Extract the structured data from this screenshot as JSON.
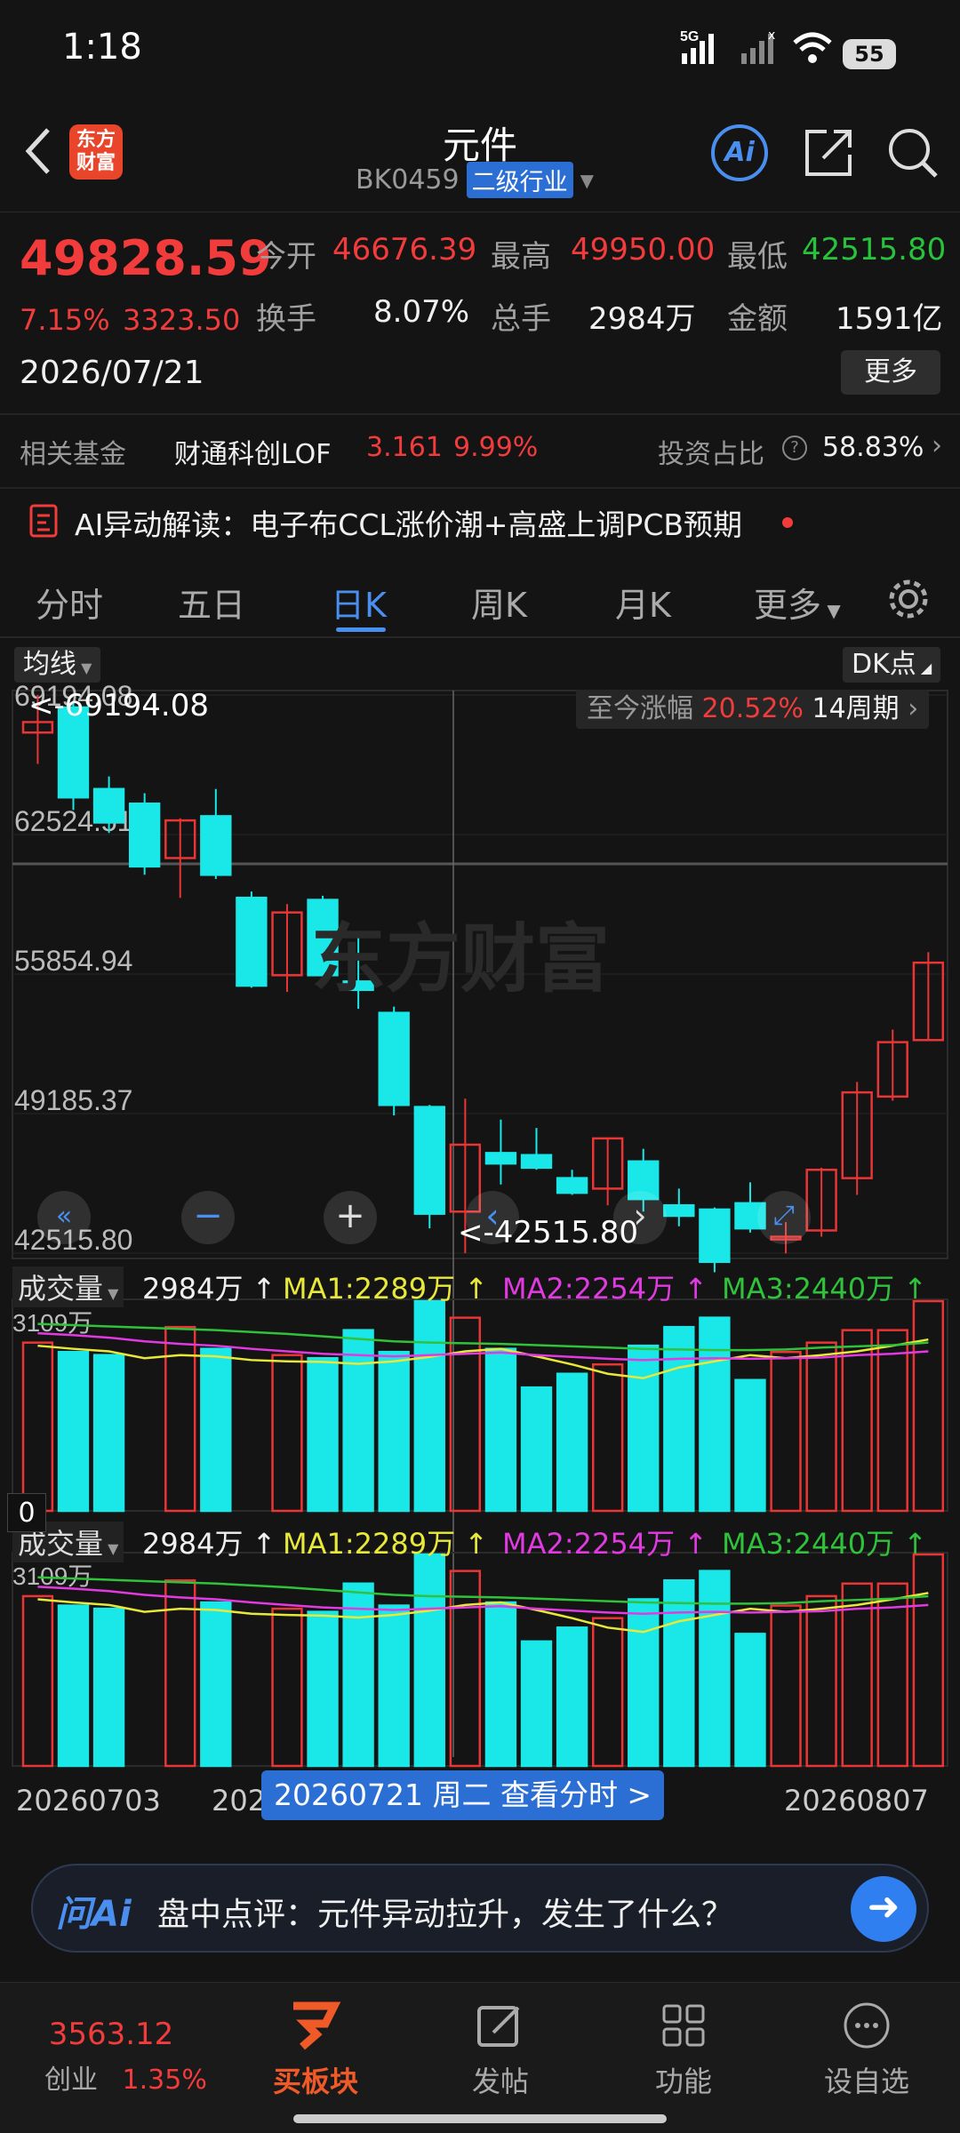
{
  "status": {
    "time": "1:18",
    "battery": "55",
    "network": "5G"
  },
  "header": {
    "title": "元件",
    "code": "BK0459",
    "category": "二级行业",
    "logo_text_line1": "东方",
    "logo_text_line2": "财富",
    "ai_label": "Ai"
  },
  "quote": {
    "price": "49828.59",
    "pct": "7.15%",
    "change": "3323.50",
    "date": "2026/07/21",
    "open_label": "今开",
    "open": "46676.39",
    "high_label": "最高",
    "high": "49950.00",
    "low_label": "最低",
    "low": "42515.80",
    "turnover_label": "换手",
    "turnover": "8.07%",
    "volume_label": "总手",
    "volume": "2984万",
    "amount_label": "金额",
    "amount": "1591亿",
    "more": "更多"
  },
  "fund": {
    "label": "相关基金",
    "name": "财通科创LOF",
    "price": "3.161",
    "pct": "9.99%",
    "ratio_label": "投资占比",
    "ratio": "58.83%"
  },
  "news": {
    "text": "AI异动解读：电子布CCL涨价潮+高盛上调PCB预期"
  },
  "tabs": [
    "分时",
    "五日",
    "日K",
    "周K",
    "月K",
    "更多"
  ],
  "chart": {
    "ma_button": "均线",
    "dk_button": "DK点",
    "gain_label": "至今涨幅",
    "gain": "20.52%",
    "period": "14周期",
    "price_ticks": [
      "69194.08",
      "62524.51",
      "55854.94",
      "49185.37",
      "42515.80"
    ],
    "high_marker": "<-69194.08",
    "low_marker": "<-42515.80",
    "watermark": "东方财富",
    "vol_label": "成交量",
    "vol_value": "2984万 ↑",
    "ma1": "MA1:2289万 ↑",
    "ma2": "MA2:2254万 ↑",
    "ma3": "MA3:2440万 ↑",
    "vol_top": "3109万",
    "vol_zero": "0",
    "date_left": "20260703",
    "date_mid_part": "202",
    "date_right": "20260807",
    "date_mid_end": "7",
    "tooltip": "20260721 周二 查看分时 >"
  },
  "chart_data": {
    "type": "candlestick",
    "ylim": [
      42515.8,
      69194.08
    ],
    "candles": [
      {
        "o": 67400,
        "c": 67900,
        "h": 69194.08,
        "l": 65900
      },
      {
        "o": 68600,
        "c": 64300,
        "h": 68900,
        "l": 63700
      },
      {
        "o": 64700,
        "c": 63100,
        "h": 65300,
        "l": 62600
      },
      {
        "o": 64000,
        "c": 61000,
        "h": 64500,
        "l": 60600
      },
      {
        "o": 61400,
        "c": 63200,
        "h": 63300,
        "l": 59500
      },
      {
        "o": 63400,
        "c": 60600,
        "h": 64700,
        "l": 60400
      },
      {
        "o": 59500,
        "c": 55300,
        "h": 59800,
        "l": 55200
      },
      {
        "o": 55800,
        "c": 58800,
        "h": 59200,
        "l": 55000
      },
      {
        "o": 59400,
        "c": 55800,
        "h": 59600,
        "l": 55800
      },
      {
        "o": 55500,
        "c": 55100,
        "h": 57600,
        "l": 54200
      },
      {
        "o": 54000,
        "c": 49600,
        "h": 54300,
        "l": 49100
      },
      {
        "o": 49500,
        "c": 44400,
        "h": 49600,
        "l": 43700
      },
      {
        "o": 44500,
        "c": 47700,
        "h": 49900,
        "l": 42515.8
      },
      {
        "o": 47300,
        "c": 46800,
        "h": 48900,
        "l": 45800
      },
      {
        "o": 47200,
        "c": 46600,
        "h": 48500,
        "l": 46500
      },
      {
        "o": 46100,
        "c": 45400,
        "h": 46500,
        "l": 45300
      },
      {
        "o": 45600,
        "c": 48000,
        "h": 48000,
        "l": 44800
      },
      {
        "o": 46900,
        "c": 45100,
        "h": 47500,
        "l": 44500
      },
      {
        "o": 44800,
        "c": 44300,
        "h": 45600,
        "l": 43800
      },
      {
        "o": 44600,
        "c": 42100,
        "h": 44700,
        "l": 41600
      },
      {
        "o": 44900,
        "c": 43700,
        "h": 45900,
        "l": 43500
      },
      {
        "o": 43300,
        "c": 43300,
        "h": 44000,
        "l": 42500
      },
      {
        "o": 43600,
        "c": 46500,
        "h": 46600,
        "l": 43300
      },
      {
        "o": 46100,
        "c": 50200,
        "h": 50700,
        "l": 45300
      },
      {
        "o": 50000,
        "c": 52600,
        "h": 53200,
        "l": 49800
      },
      {
        "o": 52700,
        "c": 56400,
        "h": 56900,
        "l": 52700
      }
    ],
    "volume_top": 3109,
    "volumes": [
      2700,
      2550,
      2500,
      0,
      2950,
      2600,
      0,
      2500,
      2450,
      2900,
      2550,
      3700,
      3100,
      2600,
      1980,
      2200,
      2350,
      2650,
      2950,
      3100,
      2100,
      2550,
      2700,
      2900,
      2900,
      3600
    ]
  }
}
